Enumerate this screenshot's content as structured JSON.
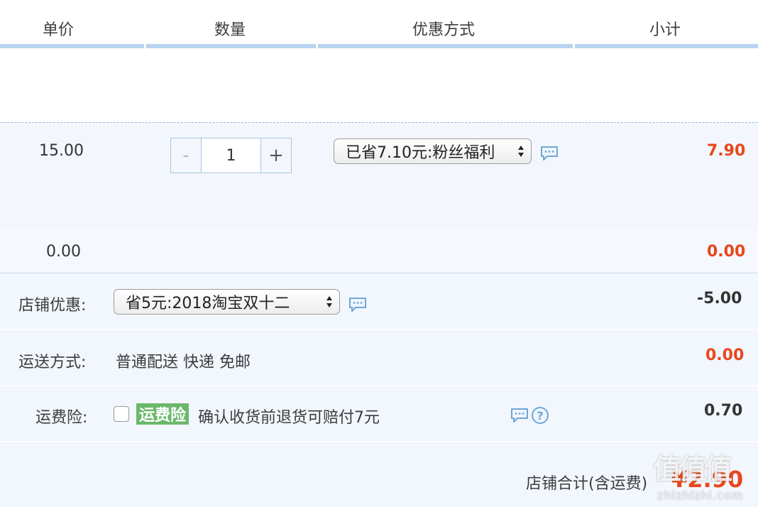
{
  "header": {
    "col_price": "单价",
    "col_qty": "数量",
    "col_discount": "优惠方式",
    "col_subtotal": "小计"
  },
  "item": {
    "price": "15.00",
    "quantity": "1",
    "minus": "-",
    "plus": "+",
    "discount_option": "已省7.10元:粉丝福利",
    "subtotal": "7.90"
  },
  "gift": {
    "price": "0.00",
    "subtotal": "0.00"
  },
  "shop_discount": {
    "label": "店铺优惠:",
    "option": "省5元:2018淘宝双十二",
    "amount": "-5.00"
  },
  "shipping": {
    "label": "运送方式:",
    "method": "普通配送 快递 免邮",
    "amount": "0.00"
  },
  "insurance": {
    "label": "运费险:",
    "badge": "运费险",
    "desc": "确认收货前退货可赔付7元",
    "amount": "0.70",
    "checked": false
  },
  "total": {
    "label": "店铺合计(含运费)",
    "amount": "¥2.90"
  },
  "watermark": {
    "logo": "值值值",
    "site": "zhizhizhi.com"
  },
  "colors": {
    "accent_red": "#e8471c",
    "header_line": "#b9d3f0",
    "badge_green": "#6bb86b",
    "icon_blue": "#6fa7d6"
  }
}
